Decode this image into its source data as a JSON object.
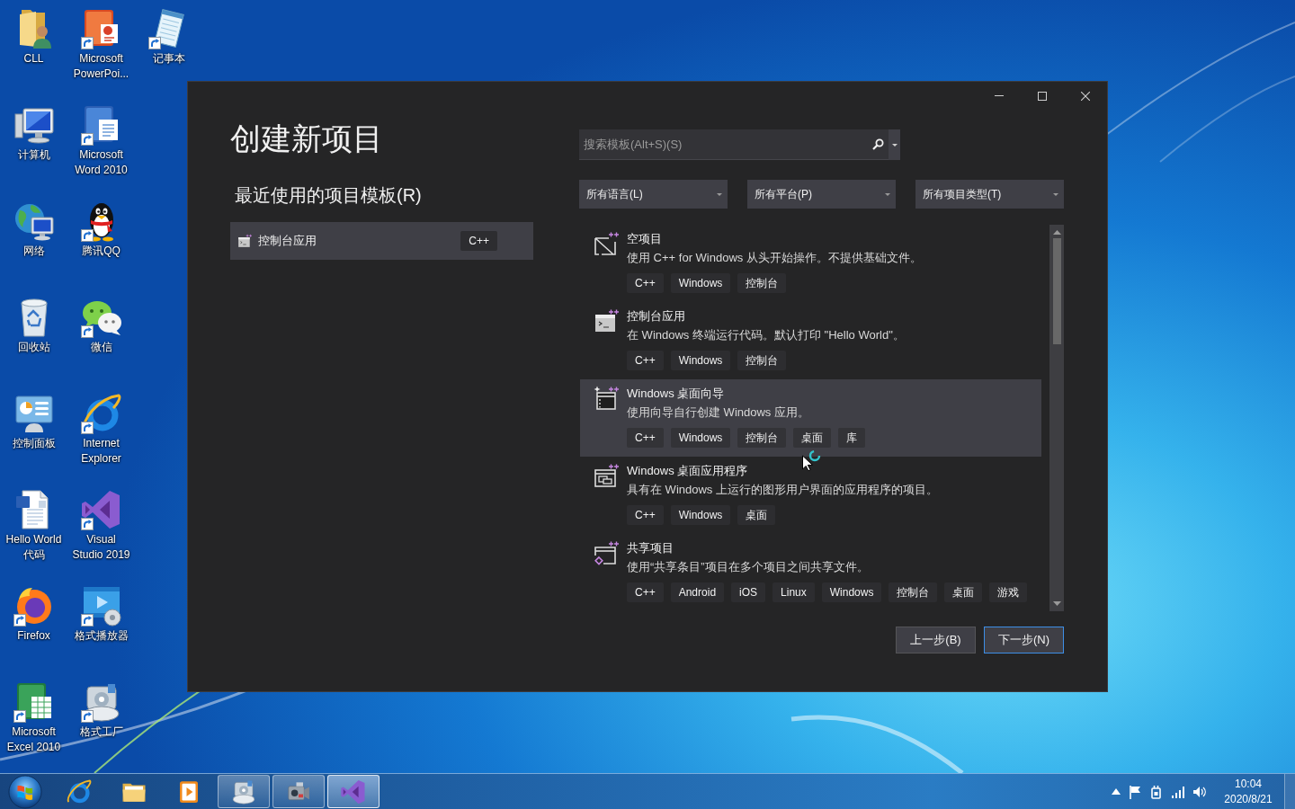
{
  "desktop_icons": [
    {
      "kind": "user-folder",
      "lines": [
        "CLL"
      ],
      "shortcut": false
    },
    {
      "kind": "computer",
      "lines": [
        "计算机"
      ],
      "shortcut": false
    },
    {
      "kind": "network",
      "lines": [
        "网络"
      ],
      "shortcut": false
    },
    {
      "kind": "bin",
      "lines": [
        "回收站"
      ],
      "shortcut": false
    },
    {
      "kind": "panel",
      "lines": [
        "控制面板"
      ],
      "shortcut": false
    },
    {
      "kind": "docfile",
      "lines": [
        "Hello World",
        "代码"
      ],
      "shortcut": false
    },
    {
      "kind": "fox",
      "lines": [
        "Firefox"
      ],
      "shortcut": true
    },
    {
      "kind": "sheet",
      "lines": [
        "Microsoft",
        "Excel 2010"
      ],
      "shortcut": true
    },
    {
      "kind": "slides",
      "lines": [
        "Microsoft",
        "PowerPoi..."
      ],
      "shortcut": true
    },
    {
      "kind": "word",
      "lines": [
        "Microsoft",
        "Word 2010"
      ],
      "shortcut": true
    },
    {
      "kind": "penguin",
      "lines": [
        "腾讯QQ"
      ],
      "shortcut": true
    },
    {
      "kind": "chat",
      "lines": [
        "微信"
      ],
      "shortcut": true
    },
    {
      "kind": "browser",
      "lines": [
        "Internet",
        "Explorer"
      ],
      "shortcut": true
    },
    {
      "kind": "ide",
      "lines": [
        "Visual",
        "Studio 2019"
      ],
      "shortcut": true
    },
    {
      "kind": "player",
      "lines": [
        "格式播放器"
      ],
      "shortcut": true
    },
    {
      "kind": "disc",
      "lines": [
        "格式工厂"
      ],
      "shortcut": true
    },
    {
      "kind": "notepad",
      "lines": [
        "记事本"
      ],
      "shortcut": true
    }
  ],
  "dialog": {
    "title": "创建新项目",
    "recent_heading": "最近使用的项目模板(R)",
    "recent": [
      {
        "kind": "console",
        "name": "控制台应用",
        "tag": "C++"
      }
    ],
    "search": {
      "placeholder": "搜索模板(Alt+S)(S)"
    },
    "filters": [
      {
        "label": "所有语言(L)"
      },
      {
        "label": "所有平台(P)"
      },
      {
        "label": "所有项目类型(T)"
      }
    ],
    "templates": [
      {
        "kind": "empty",
        "name": "空项目",
        "description": "使用 C++ for Windows 从头开始操作。不提供基础文件。",
        "tags": [
          "C++",
          "Windows",
          "控制台"
        ],
        "selected": false
      },
      {
        "kind": "console",
        "name": "控制台应用",
        "description": "在 Windows 终端运行代码。默认打印 \"Hello World\"。",
        "tags": [
          "C++",
          "Windows",
          "控制台"
        ],
        "selected": false
      },
      {
        "kind": "wizard",
        "name": "Windows 桌面向导",
        "description": "使用向导自行创建 Windows 应用。",
        "tags": [
          "C++",
          "Windows",
          "控制台",
          "桌面",
          "库"
        ],
        "selected": true
      },
      {
        "kind": "desktop",
        "name": "Windows 桌面应用程序",
        "description": "具有在 Windows 上运行的图形用户界面的应用程序的项目。",
        "tags": [
          "C++",
          "Windows",
          "桌面"
        ],
        "selected": false
      },
      {
        "kind": "shared",
        "name": "共享项目",
        "description": "使用“共享条目”项目在多个项目之间共享文件。",
        "tags": [
          "C++",
          "Android",
          "iOS",
          "Linux",
          "Windows",
          "控制台",
          "桌面",
          "游戏"
        ],
        "selected": false
      }
    ],
    "buttons": [
      {
        "label": "上一步(B)",
        "focused": false
      },
      {
        "label": "下一步(N)",
        "focused": true
      }
    ]
  },
  "taskbar": {
    "items": [
      {
        "kind": "browser",
        "running": false,
        "active": false
      },
      {
        "kind": "explorer",
        "running": false,
        "active": false
      },
      {
        "kind": "media",
        "running": false,
        "active": false
      },
      {
        "kind": "disc",
        "running": true,
        "active": false
      },
      {
        "kind": "camera",
        "running": true,
        "active": false
      },
      {
        "kind": "ide",
        "running": true,
        "active": true
      }
    ],
    "clock": {
      "time": "10:04",
      "date": "2020/8/21"
    }
  }
}
